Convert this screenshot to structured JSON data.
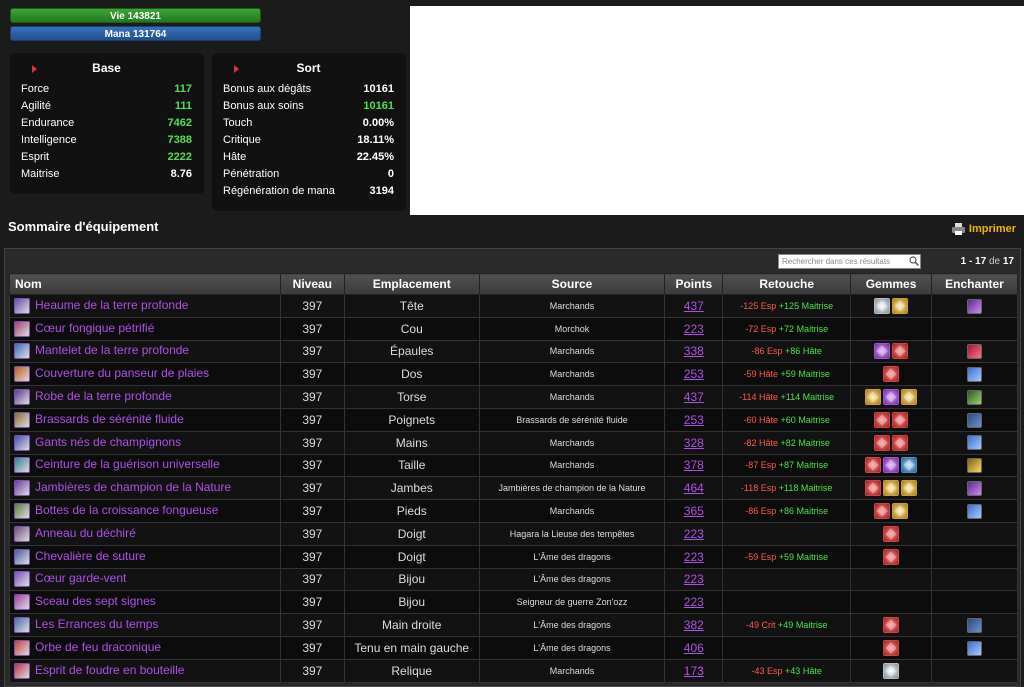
{
  "bars": {
    "vie": "Vie 143821",
    "mana": "Mana 131764"
  },
  "base": {
    "title": "Base",
    "stats": [
      {
        "label": "Force",
        "value": "117",
        "green": true
      },
      {
        "label": "Agilité",
        "value": "111",
        "green": true
      },
      {
        "label": "Endurance",
        "value": "7462",
        "green": true
      },
      {
        "label": "Intelligence",
        "value": "7388",
        "green": true
      },
      {
        "label": "Esprit",
        "value": "2222",
        "green": true
      },
      {
        "label": "Maitrise",
        "value": "8.76",
        "green": false
      }
    ]
  },
  "sort": {
    "title": "Sort",
    "stats": [
      {
        "label": "Bonus aux dégâts",
        "value": "10161",
        "green": false
      },
      {
        "label": "Bonus aux soins",
        "value": "10161",
        "green": true
      },
      {
        "label": "Touch",
        "value": "0.00%",
        "green": false
      },
      {
        "label": "Critique",
        "value": "18.11%",
        "green": false
      },
      {
        "label": "Hâte",
        "value": "22.45%",
        "green": false
      },
      {
        "label": "Pénétration",
        "value": "0",
        "green": false
      },
      {
        "label": "Régénération de mana",
        "value": "3194",
        "green": false
      }
    ]
  },
  "summary": {
    "title": "Sommaire d'équipement",
    "print_label": "Imprimer",
    "search_placeholder": "Rechercher dans ces résultats",
    "pager": {
      "range": "1 - 17",
      "of": "de",
      "total": "17"
    },
    "columns": [
      "Nom",
      "Niveau",
      "Emplacement",
      "Source",
      "Points",
      "Retouche",
      "Gemmes",
      "Enchanter"
    ],
    "rows": [
      {
        "name": "Heaume de la terre profonde",
        "level": "397",
        "slot": "Tête",
        "source": "Marchands",
        "points": "437",
        "retouche": [
          {
            "t": "-125 Esp",
            "c": "neg"
          },
          {
            "t": "+125 Maitrise",
            "c": "pos"
          }
        ],
        "gems": [
          "meta",
          "yellow"
        ],
        "ench": "purple"
      },
      {
        "name": "Cœur fongique pétrifié",
        "level": "397",
        "slot": "Cou",
        "source": "Morchok",
        "points": "223",
        "retouche": [
          {
            "t": "-72 Esp",
            "c": "neg"
          },
          {
            "t": "+72 Maitrise",
            "c": "pos"
          }
        ],
        "gems": [],
        "ench": ""
      },
      {
        "name": "Mantelet de la terre profonde",
        "level": "397",
        "slot": "Épaules",
        "source": "Marchands",
        "points": "338",
        "retouche": [
          {
            "t": "-86 Esp",
            "c": "neg"
          },
          {
            "t": "+86 Hâte",
            "c": "pos"
          }
        ],
        "gems": [
          "purple",
          "red"
        ],
        "ench": "red"
      },
      {
        "name": "Couverture du panseur de plaies",
        "level": "397",
        "slot": "Dos",
        "source": "Marchands",
        "points": "253",
        "retouche": [
          {
            "t": "-59 Hâte",
            "c": "neg"
          },
          {
            "t": "+59 Maitrise",
            "c": "pos"
          }
        ],
        "gems": [
          "red"
        ],
        "ench": "blue"
      },
      {
        "name": "Robe de la terre profonde",
        "level": "397",
        "slot": "Torse",
        "source": "Marchands",
        "points": "437",
        "retouche": [
          {
            "t": "-114 Hâte",
            "c": "neg"
          },
          {
            "t": "+114 Maitrise",
            "c": "pos"
          }
        ],
        "gems": [
          "yellow",
          "purple",
          "yellow"
        ],
        "ench": "green"
      },
      {
        "name": "Brassards de sérénité fluide",
        "level": "397",
        "slot": "Poignets",
        "source": "Brassards de sérénité fluide",
        "points": "253",
        "retouche": [
          {
            "t": "-60 Hâte",
            "c": "neg"
          },
          {
            "t": "+60 Maitrise",
            "c": "pos"
          }
        ],
        "gems": [
          "red",
          "red"
        ],
        "ench": "tome"
      },
      {
        "name": "Gants nés de champignons",
        "level": "397",
        "slot": "Mains",
        "source": "Marchands",
        "points": "328",
        "retouche": [
          {
            "t": "-82 Hâte",
            "c": "neg"
          },
          {
            "t": "+82 Maitrise",
            "c": "pos"
          }
        ],
        "gems": [
          "red",
          "red"
        ],
        "ench": "blue"
      },
      {
        "name": "Ceinture de la guérison universelle",
        "level": "397",
        "slot": "Taille",
        "source": "Marchands",
        "points": "378",
        "retouche": [
          {
            "t": "-87 Esp",
            "c": "neg"
          },
          {
            "t": "+87 Maitrise",
            "c": "pos"
          }
        ],
        "gems": [
          "red",
          "purple",
          "blue"
        ],
        "ench": "gold"
      },
      {
        "name": "Jambières de champion de la Nature",
        "level": "397",
        "slot": "Jambes",
        "source": "Jambières de champion de la Nature",
        "points": "464",
        "retouche": [
          {
            "t": "-118 Esp",
            "c": "neg"
          },
          {
            "t": "+118 Maitrise",
            "c": "pos"
          }
        ],
        "gems": [
          "red",
          "yellow",
          "yellow"
        ],
        "ench": "purple"
      },
      {
        "name": "Bottes de la croissance fongueuse",
        "level": "397",
        "slot": "Pieds",
        "source": "Marchands",
        "points": "365",
        "retouche": [
          {
            "t": "-86 Esp",
            "c": "neg"
          },
          {
            "t": "+86 Maitrise",
            "c": "pos"
          }
        ],
        "gems": [
          "red",
          "yellow"
        ],
        "ench": "blue"
      },
      {
        "name": "Anneau du déchiré",
        "level": "397",
        "slot": "Doigt",
        "source": "Hagara la Lieuse des tempêtes",
        "points": "223",
        "retouche": [],
        "gems": [
          "red"
        ],
        "ench": ""
      },
      {
        "name": "Chevalière de suture",
        "level": "397",
        "slot": "Doigt",
        "source": "L'Âme des dragons",
        "points": "223",
        "retouche": [
          {
            "t": "-59 Esp",
            "c": "neg"
          },
          {
            "t": "+59 Maitrise",
            "c": "pos"
          }
        ],
        "gems": [
          "red"
        ],
        "ench": ""
      },
      {
        "name": "Cœur garde-vent",
        "level": "397",
        "slot": "Bijou",
        "source": "L'Âme des dragons",
        "points": "223",
        "retouche": [],
        "gems": [],
        "ench": ""
      },
      {
        "name": "Sceau des sept signes",
        "level": "397",
        "slot": "Bijou",
        "source": "Seigneur de guerre Zon'ozz",
        "points": "223",
        "retouche": [],
        "gems": [],
        "ench": ""
      },
      {
        "name": "Les Errances du temps",
        "level": "397",
        "slot": "Main droite",
        "source": "L'Âme des dragons",
        "points": "382",
        "retouche": [
          {
            "t": "-49 Crit",
            "c": "neg"
          },
          {
            "t": "+49 Maitrise",
            "c": "pos"
          }
        ],
        "gems": [
          "red"
        ],
        "ench": "tome"
      },
      {
        "name": "Orbe de feu draconique",
        "level": "397",
        "slot": "Tenu en main gauche",
        "source": "L'Âme des dragons",
        "points": "406",
        "retouche": [],
        "gems": [
          "red"
        ],
        "ench": "blue"
      },
      {
        "name": "Esprit de foudre en bouteille",
        "level": "397",
        "slot": "Relique",
        "source": "Marchands",
        "points": "173",
        "retouche": [
          {
            "t": "-43 Esp",
            "c": "neg"
          },
          {
            "t": "+43 Hâte",
            "c": "pos"
          }
        ],
        "gems": [
          "meta"
        ],
        "ench": ""
      }
    ]
  }
}
